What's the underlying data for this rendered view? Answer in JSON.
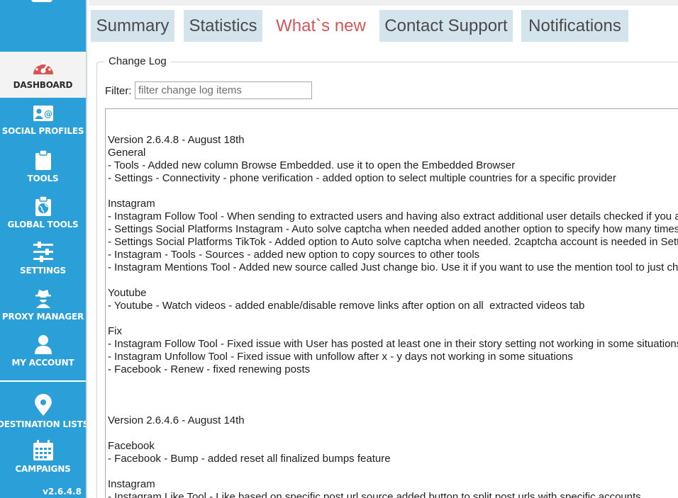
{
  "sidebar": {
    "items": [
      {
        "label": "DASHBOARD",
        "icon": "dashboard-icon"
      },
      {
        "label": "SOCIAL PROFILES",
        "icon": "social-profiles-icon"
      },
      {
        "label": "TOOLS",
        "icon": "clipboard-icon"
      },
      {
        "label": "GLOBAL TOOLS",
        "icon": "globe-clipboard-icon"
      },
      {
        "label": "SETTINGS",
        "icon": "sliders-icon"
      },
      {
        "label": "PROXY MANAGER",
        "icon": "spy-icon"
      },
      {
        "label": "MY ACCOUNT",
        "icon": "user-icon"
      },
      {
        "label": "DESTINATION LISTS",
        "icon": "location-pin-icon"
      },
      {
        "label": "CAMPAIGNS",
        "icon": "calendar-icon"
      }
    ],
    "version": "v2.6.4.8"
  },
  "tabs": [
    {
      "label": "Summary"
    },
    {
      "label": "Statistics"
    },
    {
      "label": "What`s new"
    },
    {
      "label": "Contact Support"
    },
    {
      "label": "Notifications"
    }
  ],
  "changelog": {
    "group_title": "Change Log",
    "filter_label": "Filter:",
    "filter_placeholder": "filter change log items",
    "filter_value": "",
    "lines": [
      "Version 2.6.4.8 - August 18th",
      "General",
      "- Tools - Added new column Browse Embedded. use it to open the Embedded Browser",
      "- Settings - Connectivity - phone verification - added option to select multiple countries for a specific provider",
      "",
      "Instagram",
      "- Instagram Follow Tool - When sending to extracted users and having also extract additional user details checked if you a",
      "- Settings Social Platforms Instagram - Auto solve captcha when needed added another option to specify how many times",
      "- Settings Social Platforms TikTok - Added option to Auto solve captcha when needed. 2captcha account is needed in Sett",
      "- Instagram - Tools - Sources - added new option to copy sources to other tools",
      "- Instagram Mentions Tool - Added new source called Just change bio. Use it if you want to use the mention tool to just ch",
      "",
      "Youtube",
      "- Youtube - Watch videos - added enable/disable remove links after option on all  extracted videos tab",
      "",
      "Fix",
      "- Instagram Follow Tool - Fixed issue with User has posted at least one in their story setting not working in some situations",
      "- Instagram Unfollow Tool - Fixed issue with unfollow after x - y days not working in some situations",
      "- Facebook - Renew - fixed renewing posts",
      "",
      "",
      "",
      "Version 2.6.4.6 - August 14th",
      "",
      "Facebook",
      "- Facebook - Bump - added reset all finalized bumps feature",
      "",
      "Instagram",
      "- Instagram Like Tool - Like based on specific post url source added button to split post urls with specific accounts"
    ]
  },
  "colors": {
    "sidebar": "#2a9fd8",
    "tab_inactive": "#d4e4ec",
    "tab_active_text": "#d0585a",
    "dashboard_icon": "#d9534f"
  }
}
